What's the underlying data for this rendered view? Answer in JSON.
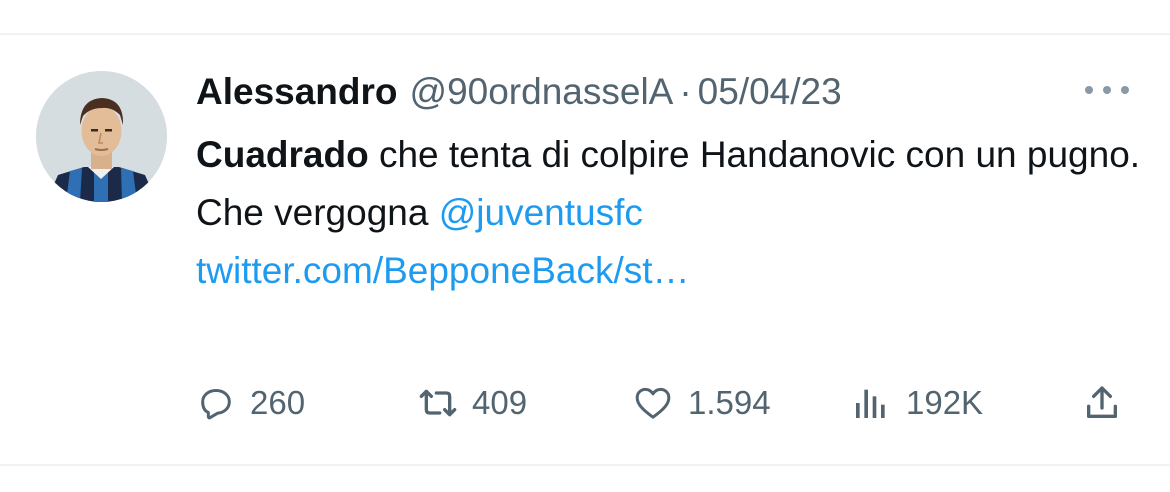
{
  "tweet": {
    "author_name": "Alessandro",
    "handle": "@90ordnasselA",
    "separator": "·",
    "date": "05/04/23",
    "text_bold": "Cuadrado",
    "text_line1_rest": " che tenta di colpire Handanovic con un pugno.",
    "text_line2": "Che vergogna ",
    "mention": "@juventusfc",
    "link": "twitter.com/BepponeBack/st…"
  },
  "actions": {
    "replies": "260",
    "retweets": "409",
    "likes": "1.594",
    "views": "192K"
  },
  "colors": {
    "link": "#1d9bf0",
    "muted": "#536471",
    "text": "#0f1419"
  },
  "icons": [
    "more-icon",
    "reply-icon",
    "retweet-icon",
    "like-icon",
    "views-icon",
    "share-icon"
  ]
}
